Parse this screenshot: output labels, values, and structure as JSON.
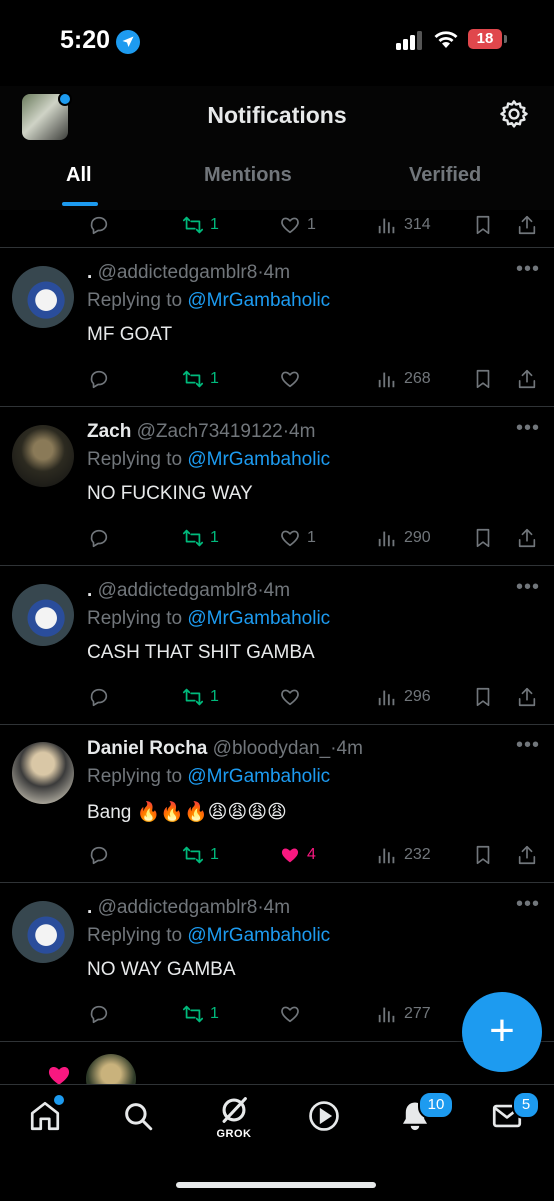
{
  "status_bar": {
    "time": "5:20",
    "battery": "18"
  },
  "header": {
    "title": "Notifications"
  },
  "tabs": [
    {
      "label": "All",
      "active": true
    },
    {
      "label": "Mentions",
      "active": false
    },
    {
      "label": "Verified",
      "active": false
    }
  ],
  "top_post_actions": {
    "retweets": "1",
    "likes": "1",
    "views": "314"
  },
  "posts": [
    {
      "name": ".",
      "handle": "@addictedgamblr8",
      "time": "4m",
      "replying_prefix": "Replying to ",
      "replying_to": "@MrGambaholic",
      "text": "MF GOAT",
      "retweets": "1",
      "likes": "",
      "views": "268"
    },
    {
      "name": "Zach",
      "handle": "@Zach73419122",
      "time": "4m",
      "replying_prefix": "Replying to ",
      "replying_to": "@MrGambaholic",
      "text": "NO FUCKING WAY",
      "retweets": "1",
      "likes": "1",
      "views": "290"
    },
    {
      "name": ".",
      "handle": "@addictedgamblr8",
      "time": "4m",
      "replying_prefix": "Replying to ",
      "replying_to": "@MrGambaholic",
      "text": "CASH THAT SHIT GAMBA",
      "retweets": "1",
      "likes": "",
      "views": "296"
    },
    {
      "name": "Daniel Rocha",
      "handle": "@bloodydan_",
      "time": "4m",
      "replying_prefix": "Replying to ",
      "replying_to": "@MrGambaholic",
      "text": "Bang 🔥🔥🔥😩😩😩😩",
      "retweets": "1",
      "likes": "4",
      "views": "232",
      "liked": true
    },
    {
      "name": ".",
      "handle": "@addictedgamblr8",
      "time": "4m",
      "replying_prefix": "Replying to ",
      "replying_to": "@MrGambaholic",
      "text": "NO WAY GAMBA",
      "retweets": "1",
      "likes": "",
      "views": "277"
    }
  ],
  "tabbar": {
    "grok_label": "GROK",
    "notifications_badge": "10",
    "messages_badge": "5"
  },
  "colors": {
    "accent": "#1d9bf0",
    "retweet": "#00ba7c",
    "like": "#f91880",
    "muted": "#71767b",
    "background": "#000000"
  },
  "icons": [
    "location-arrow-icon",
    "signal-icon",
    "wifi-icon",
    "gear-icon",
    "reply-icon",
    "retweet-icon",
    "heart-icon",
    "views-icon",
    "bookmark-icon",
    "share-icon",
    "home-icon",
    "search-icon",
    "grok-icon",
    "play-icon",
    "bell-icon",
    "mail-icon",
    "plus-icon"
  ]
}
